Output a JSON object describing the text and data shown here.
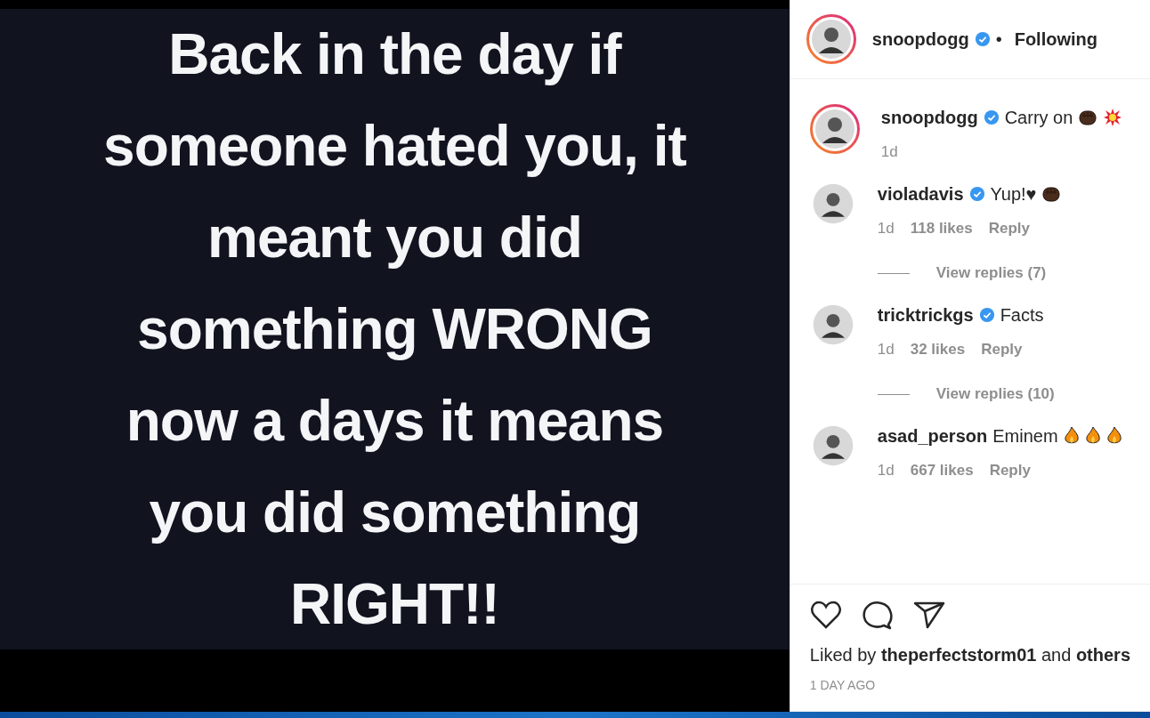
{
  "post_image": {
    "lines": [
      "Back in the day if",
      "someone hated you, it",
      "meant you did",
      "something WRONG",
      "now a days it means",
      "you did something",
      "RIGHT!!"
    ]
  },
  "header": {
    "username": "snoopdogg",
    "verified": true,
    "story_ring": true,
    "separator": "•",
    "follow_status": "Following"
  },
  "comments": [
    {
      "kind": "caption",
      "username": "snoopdogg",
      "verified": true,
      "story_ring": true,
      "text": "Carry on",
      "emoji": [
        {
          "kind": "fist"
        },
        {
          "kind": "explosion"
        }
      ],
      "time": "1d"
    },
    {
      "kind": "comment",
      "username": "violadavis",
      "verified": true,
      "story_ring": false,
      "text": "Yup!♥",
      "emoji": [
        {
          "kind": "fist"
        }
      ],
      "time": "1d",
      "likes": "118 likes",
      "reply": "Reply",
      "view_replies": "View replies (7)"
    },
    {
      "kind": "comment",
      "username": "tricktrickgs",
      "verified": true,
      "story_ring": false,
      "text": "Facts",
      "time": "1d",
      "likes": "32 likes",
      "reply": "Reply",
      "view_replies": "View replies (10)"
    },
    {
      "kind": "comment",
      "username": "asad_person",
      "verified": false,
      "story_ring": false,
      "text": "Eminem",
      "emoji": [
        {
          "kind": "fire"
        },
        {
          "kind": "fire"
        },
        {
          "kind": "fire"
        }
      ],
      "time": "1d",
      "likes": "667 likes",
      "reply": "Reply"
    }
  ],
  "actions": {
    "liked": false
  },
  "likes_line": "Liked by **theperfectstorm01** and **others**",
  "timestamp": "1 DAY AGO"
}
